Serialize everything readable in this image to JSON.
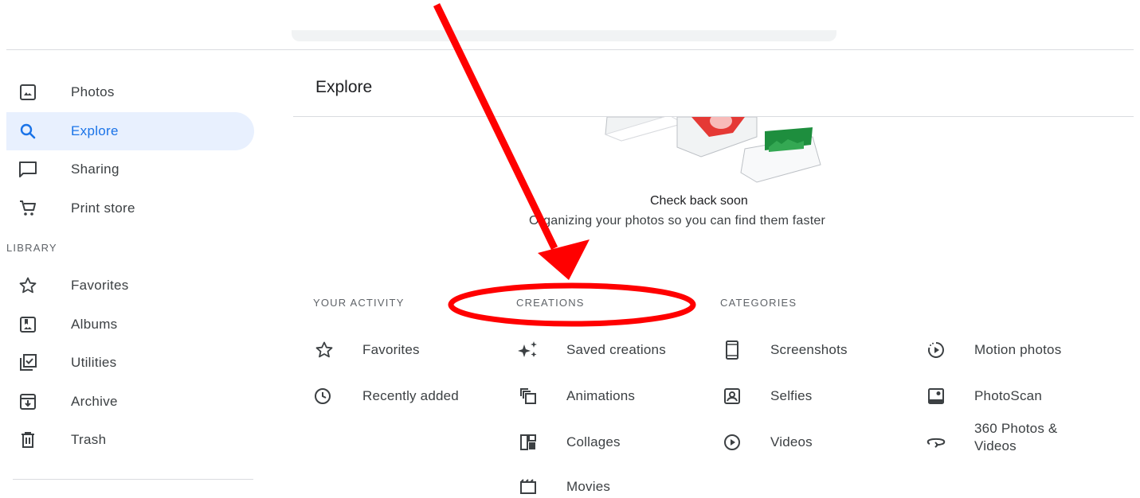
{
  "sidebar": {
    "items": [
      {
        "label": "Photos"
      },
      {
        "label": "Explore"
      },
      {
        "label": "Sharing"
      },
      {
        "label": "Print store"
      }
    ],
    "library_label": "LIBRARY",
    "library_items": [
      {
        "label": "Favorites"
      },
      {
        "label": "Albums"
      },
      {
        "label": "Utilities"
      },
      {
        "label": "Archive"
      },
      {
        "label": "Trash"
      }
    ]
  },
  "main": {
    "title": "Explore",
    "empty_state": {
      "title": "Check back soon",
      "subtitle": "Organizing your photos so you can find them faster"
    },
    "sections": {
      "your_activity": {
        "header": "YOUR ACTIVITY",
        "items": [
          {
            "label": "Favorites"
          },
          {
            "label": "Recently added"
          }
        ]
      },
      "creations": {
        "header": "CREATIONS",
        "items": [
          {
            "label": "Saved creations"
          },
          {
            "label": "Animations"
          },
          {
            "label": "Collages"
          },
          {
            "label": "Movies"
          }
        ]
      },
      "categories": {
        "header": "CATEGORIES",
        "items": [
          {
            "label": "Screenshots"
          },
          {
            "label": "Selfies"
          },
          {
            "label": "Videos"
          },
          {
            "label": "Motion photos"
          },
          {
            "label": "PhotoScan"
          },
          {
            "label": "360 Photos & Videos"
          }
        ]
      }
    }
  },
  "colors": {
    "accent": "#1a73e8",
    "active_bg": "#e8f0fe",
    "icon_gray": "#3c4043",
    "annotation_red": "#ff0000"
  }
}
